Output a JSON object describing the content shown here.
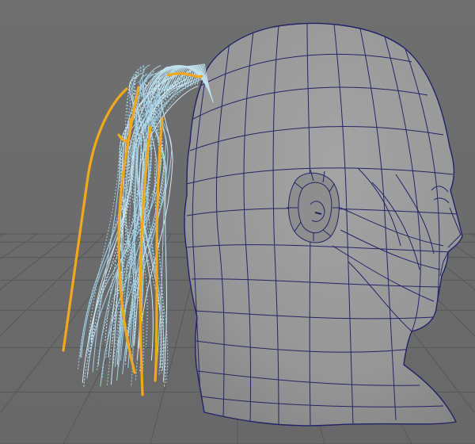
{
  "viewport": {
    "name": "perspective-viewport",
    "background_color": "#6b6b6b",
    "grid": true,
    "grid_color": "#555555"
  },
  "scene": {
    "objects": [
      {
        "name": "head-mesh",
        "display": "wireframe-on-shaded",
        "surface_color": "#9a9a9a",
        "edge_color": "#24246a"
      },
      {
        "name": "ponytail-hair-curves",
        "display": "curves",
        "strand_color": "#9fd0e6",
        "selected_color": "#f2a81a"
      }
    ]
  }
}
